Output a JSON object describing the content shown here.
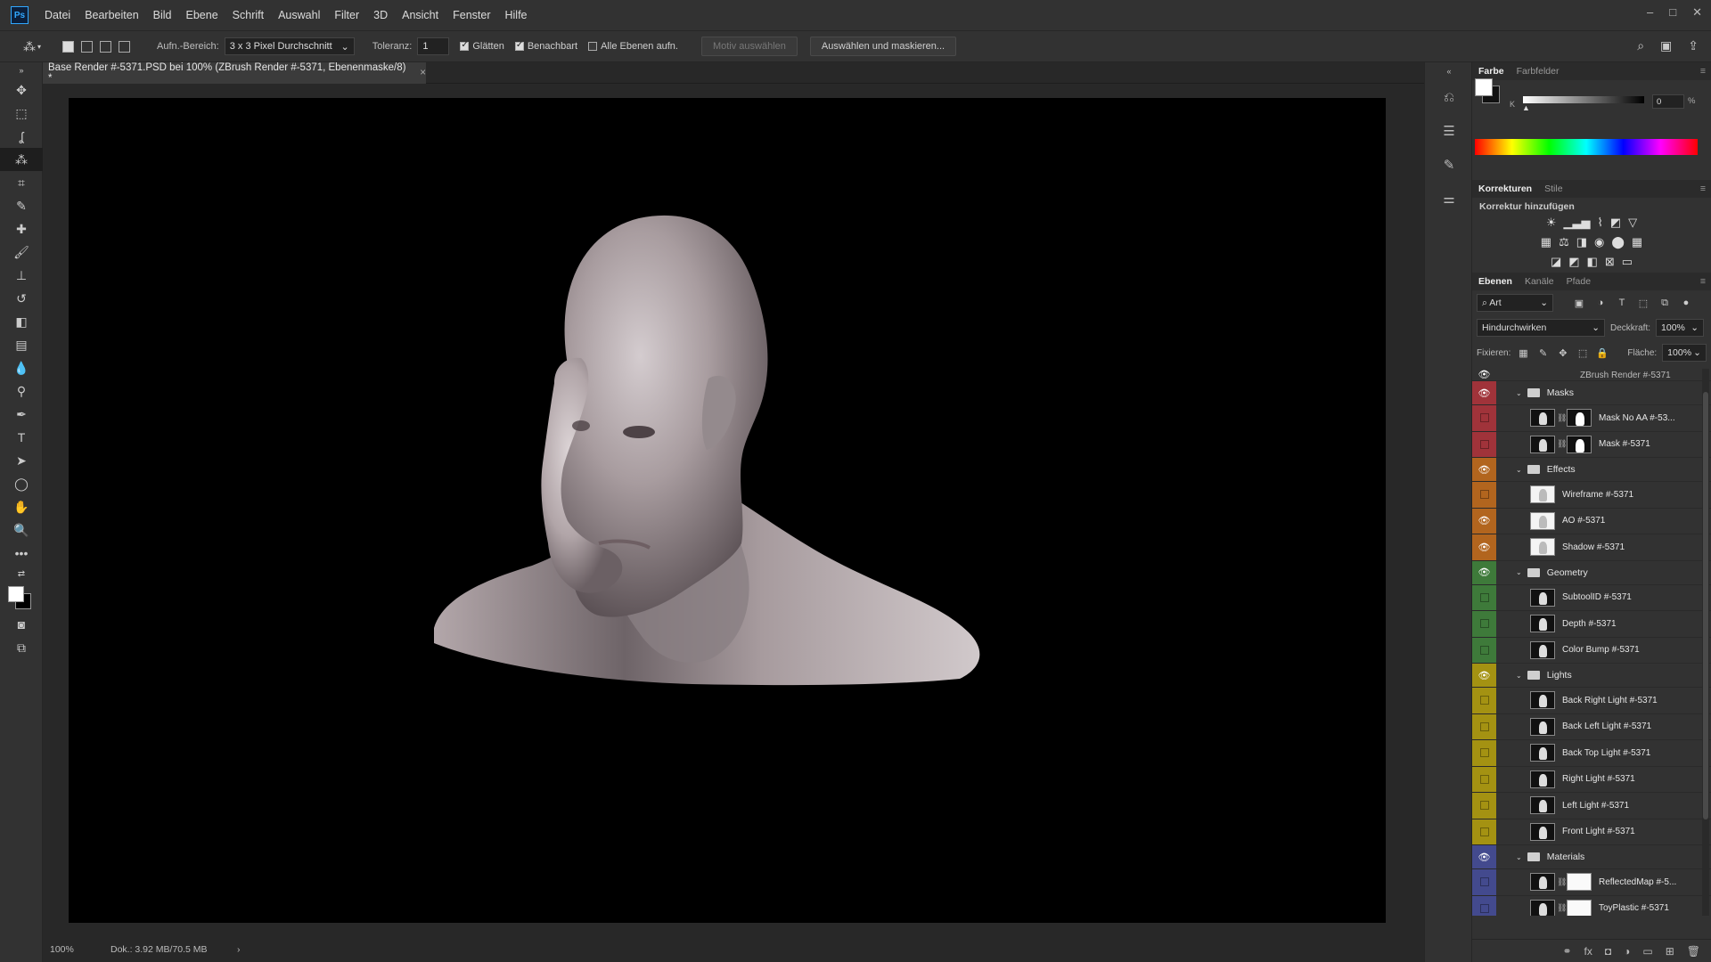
{
  "app": {
    "logo": "Ps"
  },
  "menu": [
    "Datei",
    "Bearbeiten",
    "Bild",
    "Ebene",
    "Schrift",
    "Auswahl",
    "Filter",
    "3D",
    "Ansicht",
    "Fenster",
    "Hilfe"
  ],
  "window_controls": {
    "minimize": "–",
    "maximize": "□",
    "close": "✕"
  },
  "options": {
    "sample_label": "Aufn.-Bereich:",
    "sample_value": "3 x 3 Pixel Durchschnitt",
    "tolerance_label": "Toleranz:",
    "tolerance_value": "1",
    "antialias_label": "Glätten",
    "antialias_checked": true,
    "contiguous_label": "Benachbart",
    "contiguous_checked": true,
    "all_layers_label": "Alle Ebenen aufn.",
    "all_layers_checked": false,
    "subject_button": "Motiv auswählen",
    "select_mask_button": "Auswählen und maskieren..."
  },
  "document": {
    "tab_title": "Base Render #-5371.PSD bei 100% (ZBrush Render #-5371, Ebenenmaske/8) *",
    "close": "×"
  },
  "status": {
    "zoom": "100%",
    "doc_info": "Dok.: 3.92 MB/70.5 MB",
    "arrow": "›"
  },
  "color_panel": {
    "tabs": [
      "Farbe",
      "Farbfelder"
    ],
    "active_tab": "Farbe",
    "k_label": "K",
    "k_value": "0",
    "k_unit": "%",
    "k_fraction": 0
  },
  "adjustments_panel": {
    "tabs": [
      "Korrekturen",
      "Stile"
    ],
    "active_tab": "Korrekturen",
    "title": "Korrektur hinzufügen"
  },
  "layers_panel": {
    "tabs": [
      "Ebenen",
      "Kanäle",
      "Pfade"
    ],
    "active_tab": "Ebenen",
    "filter_kind": "Art",
    "blend_mode": "Hindurchwirken",
    "opacity_label": "Deckkraft:",
    "opacity_value": "100%",
    "lock_label": "Fixieren:",
    "fill_label": "Fläche:",
    "fill_value": "100%",
    "top_partial_layer": "ZBrush Render #-5371",
    "layers": [
      {
        "type": "group",
        "name": "Masks",
        "color": "#a0333a",
        "visible": true
      },
      {
        "type": "layer",
        "name": "Mask No AA #-53...",
        "color": "#a0333a",
        "visible": false,
        "thumb": "dark",
        "mask": "dark"
      },
      {
        "type": "layer",
        "name": "Mask #-5371",
        "color": "#a0333a",
        "visible": false,
        "thumb": "dark",
        "mask": "dark"
      },
      {
        "type": "group",
        "name": "Effects",
        "color": "#b2651e",
        "visible": true
      },
      {
        "type": "layer",
        "name": "Wireframe #-5371",
        "color": "#b2651e",
        "visible": false,
        "thumb": "white"
      },
      {
        "type": "layer",
        "name": "AO #-5371",
        "color": "#b2651e",
        "visible": true,
        "thumb": "white"
      },
      {
        "type": "layer",
        "name": "Shadow #-5371",
        "color": "#b2651e",
        "visible": true,
        "thumb": "white"
      },
      {
        "type": "group",
        "name": "Geometry",
        "color": "#3e7a3a",
        "visible": true
      },
      {
        "type": "layer",
        "name": "SubtoolID #-5371",
        "color": "#3e7a3a",
        "visible": false,
        "thumb": "dark"
      },
      {
        "type": "layer",
        "name": "Depth #-5371",
        "color": "#3e7a3a",
        "visible": false,
        "thumb": "dark"
      },
      {
        "type": "layer",
        "name": "Color Bump #-5371",
        "color": "#3e7a3a",
        "visible": false,
        "thumb": "dark"
      },
      {
        "type": "group",
        "name": "Lights",
        "color": "#a49212",
        "visible": true
      },
      {
        "type": "layer",
        "name": "Back Right Light #-5371",
        "color": "#a49212",
        "visible": false,
        "thumb": "dark"
      },
      {
        "type": "layer",
        "name": "Back Left Light #-5371",
        "color": "#a49212",
        "visible": false,
        "thumb": "dark"
      },
      {
        "type": "layer",
        "name": "Back Top Light #-5371",
        "color": "#a49212",
        "visible": false,
        "thumb": "dark"
      },
      {
        "type": "layer",
        "name": "Right Light #-5371",
        "color": "#a49212",
        "visible": false,
        "thumb": "dark"
      },
      {
        "type": "layer",
        "name": "Left Light #-5371",
        "color": "#a49212",
        "visible": false,
        "thumb": "dark"
      },
      {
        "type": "layer",
        "name": "Front Light #-5371",
        "color": "#a49212",
        "visible": false,
        "thumb": "dark"
      },
      {
        "type": "group",
        "name": "Materials",
        "color": "#434a8e",
        "visible": true
      },
      {
        "type": "layer",
        "name": "ReflectedMap #-5...",
        "color": "#434a8e",
        "visible": false,
        "thumb": "dark",
        "mask": "white"
      },
      {
        "type": "layer",
        "name": "ToyPlastic #-5371",
        "color": "#434a8e",
        "visible": false,
        "thumb": "dark",
        "mask": "white"
      }
    ]
  }
}
